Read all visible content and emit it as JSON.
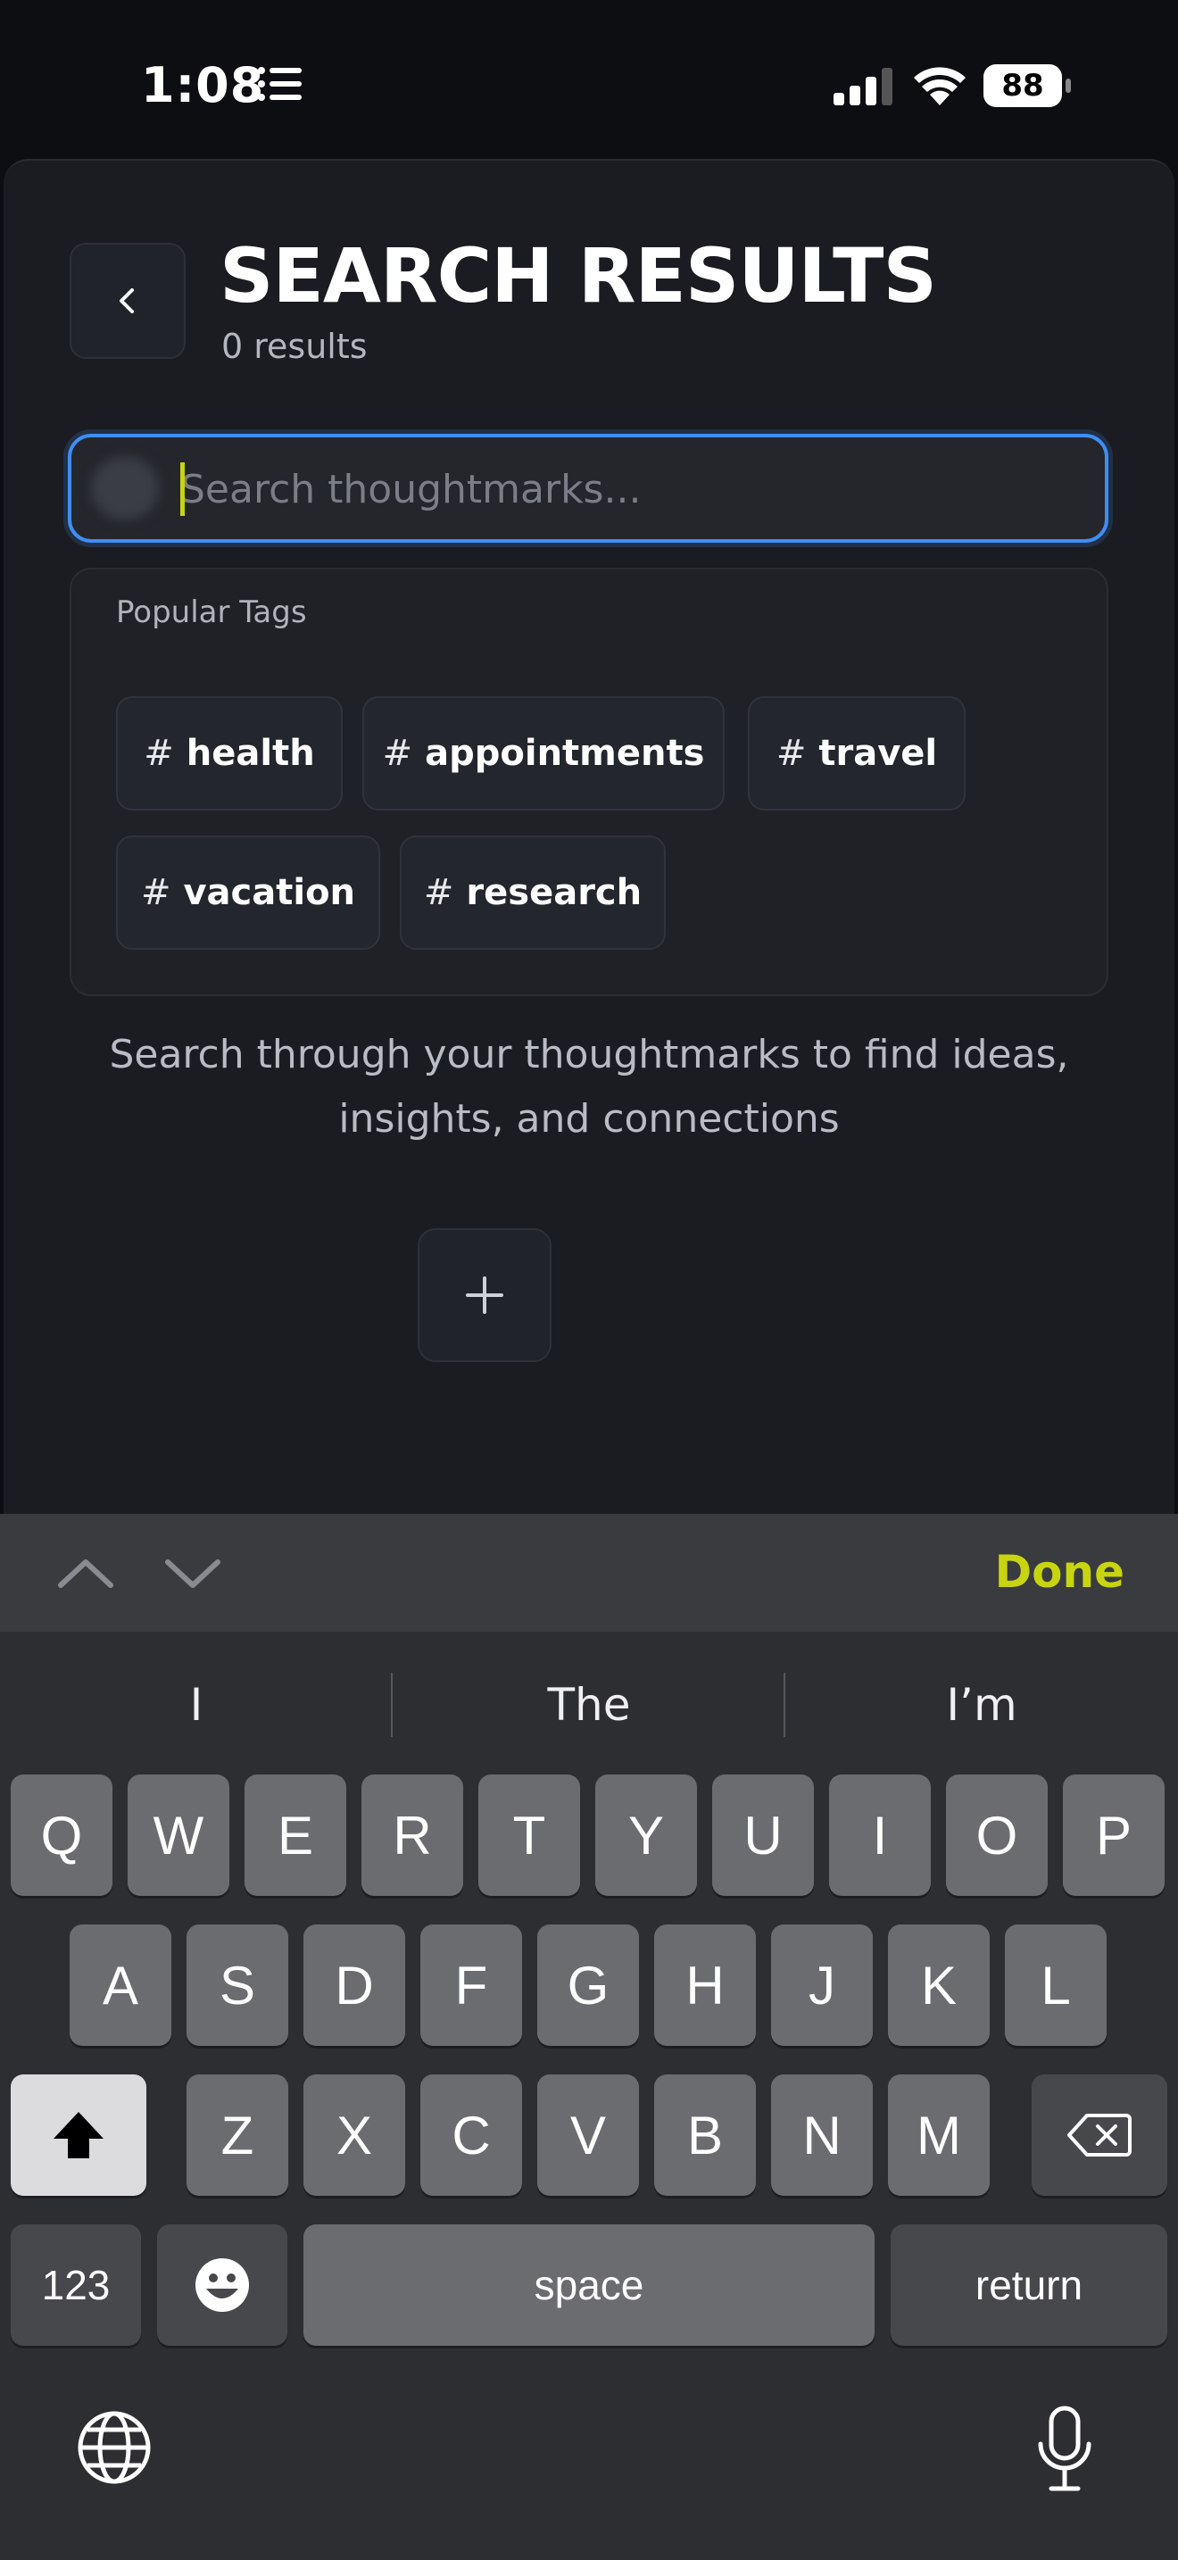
{
  "status_bar": {
    "time": "1:08",
    "battery": "88"
  },
  "header": {
    "title": "SEARCH RESULTS",
    "result_count": "0 results"
  },
  "search": {
    "value": "",
    "placeholder": "Search thoughtmarks..."
  },
  "popular_tags": {
    "label": "Popular Tags",
    "hash": "#",
    "tags": [
      "health",
      "appointments",
      "travel",
      "vacation",
      "research"
    ]
  },
  "hint": "Search through your thoughtmarks to find ideas, insights, and connections",
  "keyboard": {
    "done_label": "Done",
    "suggestions": [
      "I",
      "The",
      "I’m"
    ],
    "row1": [
      "Q",
      "W",
      "E",
      "R",
      "T",
      "Y",
      "U",
      "I",
      "O",
      "P"
    ],
    "row2": [
      "A",
      "S",
      "D",
      "F",
      "G",
      "H",
      "J",
      "K",
      "L"
    ],
    "row3": [
      "Z",
      "X",
      "C",
      "V",
      "B",
      "N",
      "M"
    ],
    "numbers_label": "123",
    "space_label": "space",
    "return_label": "return"
  },
  "colors": {
    "accent": "#c8d40f",
    "focus_border": "#3f8ef5",
    "background": "#1b1c21"
  }
}
